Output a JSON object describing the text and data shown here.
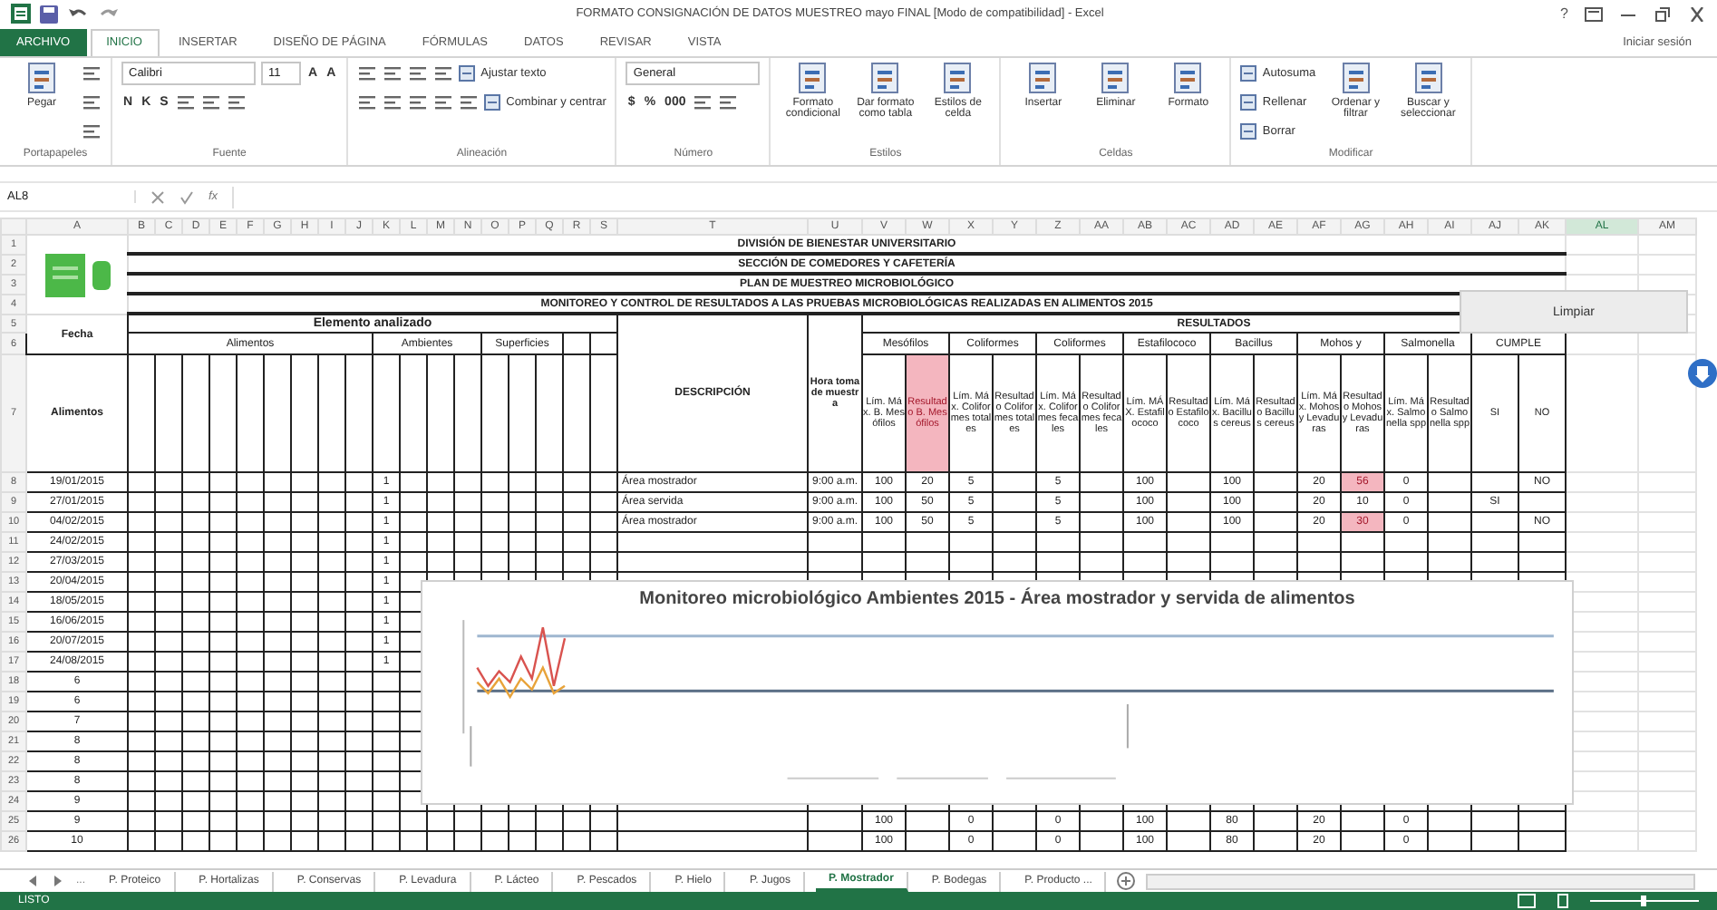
{
  "window": {
    "title": "FORMATO CONSIGNACIÓN DE DATOS MUESTREO mayo FINAL [Modo de compatibilidad] - Excel",
    "help": "?"
  },
  "ribbon_tabs": [
    {
      "label": "ARCHIVO",
      "kind": "file"
    },
    {
      "label": "INICIO",
      "kind": "tab",
      "selected": true
    },
    {
      "label": "INSERTAR",
      "kind": "tab",
      "selected": false
    },
    {
      "label": "DISEÑO DE PÁGINA",
      "kind": "tab",
      "selected": false
    },
    {
      "label": "FÓRMULAS",
      "kind": "tab",
      "selected": false
    },
    {
      "label": "DATOS",
      "kind": "tab",
      "selected": false
    },
    {
      "label": "REVISAR",
      "kind": "tab",
      "selected": false
    },
    {
      "label": "VISTA",
      "kind": "tab",
      "selected": false
    }
  ],
  "sign_in": "Iniciar sesión",
  "ribbon_groups": [
    {
      "label": "Portapapeles",
      "items": [
        {
          "kind": "large",
          "label": "Pegar"
        },
        {
          "kind": "stack",
          "lines": [
            {
              "items": [
                {
                  "kind": "icon"
                }
              ]
            },
            {
              "items": [
                {
                  "kind": "icon"
                }
              ]
            },
            {
              "items": [
                {
                  "kind": "icon"
                }
              ]
            }
          ]
        }
      ]
    },
    {
      "label": "Fuente",
      "items": [
        {
          "kind": "stack",
          "lines": [
            {
              "items": [
                {
                  "kind": "field",
                  "label": "Calibri"
                },
                {
                  "kind": "smallfield",
                  "label": "11"
                },
                {
                  "kind": "glyph",
                  "label": "A"
                },
                {
                  "kind": "glyph",
                  "label": "A"
                }
              ]
            },
            {
              "items": [
                {
                  "kind": "glyph",
                  "label": "N"
                },
                {
                  "kind": "glyph",
                  "label": "K"
                },
                {
                  "kind": "glyph",
                  "label": "S"
                },
                {
                  "kind": "icon"
                },
                {
                  "kind": "icon"
                },
                {
                  "kind": "icon"
                }
              ]
            }
          ]
        }
      ]
    },
    {
      "label": "Alineación",
      "items": [
        {
          "kind": "stack",
          "lines": [
            {
              "items": [
                {
                  "kind": "icon"
                },
                {
                  "kind": "icon"
                },
                {
                  "kind": "icon"
                },
                {
                  "kind": "icon"
                },
                {
                  "kind": "labeled",
                  "label": "Ajustar texto"
                }
              ]
            },
            {
              "items": [
                {
                  "kind": "icon"
                },
                {
                  "kind": "icon"
                },
                {
                  "kind": "icon"
                },
                {
                  "kind": "icon"
                },
                {
                  "kind": "icon"
                },
                {
                  "kind": "labeled",
                  "label": "Combinar y centrar"
                }
              ]
            }
          ]
        }
      ]
    },
    {
      "label": "Número",
      "items": [
        {
          "kind": "stack",
          "lines": [
            {
              "items": [
                {
                  "kind": "field",
                  "label": "General"
                }
              ]
            },
            {
              "items": [
                {
                  "kind": "glyph",
                  "label": "$"
                },
                {
                  "kind": "glyph",
                  "label": "%"
                },
                {
                  "kind": "glyph",
                  "label": "000"
                },
                {
                  "kind": "icon"
                },
                {
                  "kind": "icon"
                }
              ]
            }
          ]
        }
      ]
    },
    {
      "label": "Estilos",
      "items": [
        {
          "kind": "large",
          "label": "Formato condicional"
        },
        {
          "kind": "large",
          "label": "Dar formato como tabla"
        },
        {
          "kind": "large",
          "label": "Estilos de celda"
        }
      ]
    },
    {
      "label": "Celdas",
      "items": [
        {
          "kind": "large",
          "label": "Insertar"
        },
        {
          "kind": "large",
          "label": "Eliminar"
        },
        {
          "kind": "large",
          "label": "Formato"
        }
      ]
    },
    {
      "label": "Modificar",
      "items": [
        {
          "kind": "stack",
          "lines": [
            {
              "items": [
                {
                  "kind": "labeled",
                  "label": "Autosuma"
                }
              ]
            },
            {
              "items": [
                {
                  "kind": "labeled",
                  "label": "Rellenar"
                }
              ]
            },
            {
              "items": [
                {
                  "kind": "labeled",
                  "label": "Borrar"
                }
              ]
            }
          ]
        },
        {
          "kind": "large",
          "label": "Ordenar y filtrar"
        },
        {
          "kind": "large",
          "label": "Buscar y seleccionar"
        }
      ]
    }
  ],
  "formula_bar": {
    "name_box": "AL8",
    "function_label": "fx"
  },
  "columns": [
    {
      "label": "A",
      "selected": false
    },
    {
      "label": "B",
      "selected": false
    },
    {
      "label": "C",
      "selected": false
    },
    {
      "label": "D",
      "selected": false
    },
    {
      "label": "E",
      "selected": false
    },
    {
      "label": "F",
      "selected": false
    },
    {
      "label": "G",
      "selected": false
    },
    {
      "label": "H",
      "selected": false
    },
    {
      "label": "I",
      "selected": false
    },
    {
      "label": "J",
      "selected": false
    },
    {
      "label": "K",
      "selected": false
    },
    {
      "label": "L",
      "selected": false
    },
    {
      "label": "M",
      "selected": false
    },
    {
      "label": "N",
      "selected": false
    },
    {
      "label": "O",
      "selected": false
    },
    {
      "label": "P",
      "selected": false
    },
    {
      "label": "Q",
      "selected": false
    },
    {
      "label": "R",
      "selected": false
    },
    {
      "label": "S",
      "selected": false
    },
    {
      "label": "T",
      "selected": false
    },
    {
      "label": "U",
      "selected": false
    },
    {
      "label": "V",
      "selected": false
    },
    {
      "label": "W",
      "selected": false
    },
    {
      "label": "X",
      "selected": false
    },
    {
      "label": "Y",
      "selected": false
    },
    {
      "label": "Z",
      "selected": false
    },
    {
      "label": "AA",
      "selected": false
    },
    {
      "label": "AB",
      "selected": false
    },
    {
      "label": "AC",
      "selected": false
    },
    {
      "label": "AD",
      "selected": false
    },
    {
      "label": "AE",
      "selected": false
    },
    {
      "label": "AF",
      "selected": false
    },
    {
      "label": "AG",
      "selected": false
    },
    {
      "label": "AH",
      "selected": false
    },
    {
      "label": "AI",
      "selected": false
    },
    {
      "label": "AJ",
      "selected": false
    },
    {
      "label": "AK",
      "selected": false
    },
    {
      "label": "AL",
      "selected": true
    },
    {
      "label": "AM",
      "selected": false
    }
  ],
  "sheet": {
    "header_row_numbers": [
      "1",
      "2",
      "3",
      "4",
      "5",
      "6",
      "7"
    ],
    "titles": [
      "DIVISIÓN DE BIENESTAR UNIVERSITARIO",
      "SECCIÓN DE COMEDORES Y CAFETERÍA",
      "PLAN DE MUESTREO MICROBIOLÓGICO",
      "MONITOREO Y CONTROL DE RESULTADOS A LAS PRUEBAS MICROBIOLÓGICAS REALIZADAS EN ALIMENTOS 2015"
    ],
    "clear_button": "Limpiar",
    "header": {
      "date": "Fecha",
      "element": "Elemento analizado",
      "groups": [
        "Alimentos",
        "Ambientes",
        "Superficies"
      ],
      "food": "Alimentos",
      "description": "DESCRIPCIÓN",
      "time": "Hora toma de muestra",
      "results": "RESULTADOS",
      "result_groups": [
        "Mesófilos",
        "Coliformes",
        "Coliformes",
        "Estafilococo",
        "Bacillus",
        "Mohos y",
        "Salmonella",
        "CUMPLE"
      ],
      "result_columns": [
        {
          "label": "Lím. Máx. B. Mesófilos",
          "alert": false
        },
        {
          "label": "Resultado B. Mesófilos",
          "alert": true
        },
        {
          "label": "Lím. Máx. Coliformes totales",
          "alert": false
        },
        {
          "label": "Resultado Coliformes totales",
          "alert": false
        },
        {
          "label": "Lím. Máx. Coliformes fecales",
          "alert": false
        },
        {
          "label": "Resultado Coliformes fecales",
          "alert": false
        },
        {
          "label": "Lím. MÁX. Estafilococo",
          "alert": false
        },
        {
          "label": "Resultado Estafilococo",
          "alert": false
        },
        {
          "label": "Lím. Máx. Bacillus cereus",
          "alert": false
        },
        {
          "label": "Resultado Bacillus cereus",
          "alert": false
        },
        {
          "label": "Lím. Máx. Mohos y Levaduras",
          "alert": false
        },
        {
          "label": "Resultado Mohos y Levaduras",
          "alert": false
        },
        {
          "label": "Lím. Máx. Salmonella spp",
          "alert": false
        },
        {
          "label": "Resultado Salmonella spp",
          "alert": false
        },
        {
          "label": "SI",
          "alert": false
        },
        {
          "label": "NO",
          "alert": false
        }
      ]
    },
    "rows": [
      {
        "n": "8",
        "date": "19/01/2015",
        "mark": "1",
        "description": "Área mostrador",
        "time": "9:00 a.m.",
        "results": [
          {
            "text": "100",
            "alert": false
          },
          {
            "text": "20",
            "alert": false
          },
          {
            "text": "5",
            "alert": false
          },
          {
            "alert": false
          },
          {
            "text": "5",
            "alert": false
          },
          {
            "alert": false
          },
          {
            "text": "100",
            "alert": false
          },
          {
            "alert": false
          },
          {
            "text": "100",
            "alert": false
          },
          {
            "alert": false
          },
          {
            "text": "20",
            "alert": false
          },
          {
            "text": "56",
            "alert": true
          },
          {
            "text": "0",
            "alert": false
          },
          {
            "alert": false
          },
          {
            "alert": false
          },
          {
            "text": "NO",
            "alert": false
          }
        ]
      },
      {
        "n": "9",
        "date": "27/01/2015",
        "mark": "1",
        "description": "Área servida",
        "time": "9:00 a.m.",
        "results": [
          {
            "text": "100",
            "alert": false
          },
          {
            "text": "50",
            "alert": false
          },
          {
            "text": "5",
            "alert": false
          },
          {
            "alert": false
          },
          {
            "text": "5",
            "alert": false
          },
          {
            "alert": false
          },
          {
            "text": "100",
            "alert": false
          },
          {
            "alert": false
          },
          {
            "text": "100",
            "alert": false
          },
          {
            "alert": false
          },
          {
            "text": "20",
            "alert": false
          },
          {
            "text": "10",
            "alert": false
          },
          {
            "text": "0",
            "alert": false
          },
          {
            "alert": false
          },
          {
            "text": "SI",
            "alert": false
          },
          {
            "alert": false
          }
        ]
      },
      {
        "n": "10",
        "date": "04/02/2015",
        "mark": "1",
        "description": "Área mostrador",
        "time": "9:00 a.m.",
        "results": [
          {
            "text": "100",
            "alert": false
          },
          {
            "text": "50",
            "alert": false
          },
          {
            "text": "5",
            "alert": false
          },
          {
            "alert": false
          },
          {
            "text": "5",
            "alert": false
          },
          {
            "alert": false
          },
          {
            "text": "100",
            "alert": false
          },
          {
            "alert": false
          },
          {
            "text": "100",
            "alert": false
          },
          {
            "alert": false
          },
          {
            "text": "20",
            "alert": false
          },
          {
            "text": "30",
            "alert": true
          },
          {
            "text": "0",
            "alert": false
          },
          {
            "alert": false
          },
          {
            "alert": false
          },
          {
            "text": "NO",
            "alert": false
          }
        ]
      },
      {
        "n": "11",
        "date": "24/02/2015",
        "mark": "1"
      },
      {
        "n": "12",
        "date": "27/03/2015",
        "mark": "1"
      },
      {
        "n": "13",
        "date": "20/04/2015",
        "mark": "1"
      },
      {
        "n": "14",
        "date": "18/05/2015",
        "mark": "1"
      },
      {
        "n": "15",
        "date": "16/06/2015",
        "mark": "1"
      },
      {
        "n": "16",
        "date": "20/07/2015",
        "mark": "1"
      },
      {
        "n": "17",
        "date": "24/08/2015",
        "mark": "1"
      },
      {
        "n": "18",
        "date": "6"
      },
      {
        "n": "19",
        "date": "6"
      },
      {
        "n": "20",
        "date": "7"
      },
      {
        "n": "21",
        "date": "8"
      },
      {
        "n": "22",
        "date": "8"
      },
      {
        "n": "23",
        "date": "8"
      },
      {
        "n": "24",
        "date": "9"
      },
      {
        "n": "25",
        "date": "9",
        "results": [
          {
            "text": "100",
            "alert": false
          },
          {
            "alert": false
          },
          {
            "text": "0",
            "alert": false
          },
          {
            "alert": false
          },
          {
            "text": "0",
            "alert": false
          },
          {
            "alert": false
          },
          {
            "text": "100",
            "alert": false
          },
          {
            "alert": false
          },
          {
            "text": "80",
            "alert": false
          },
          {
            "alert": false
          },
          {
            "text": "20",
            "alert": false
          },
          {
            "alert": false
          },
          {
            "text": "0",
            "alert": false
          },
          {
            "alert": false
          },
          {
            "alert": false
          },
          {
            "alert": false
          }
        ]
      },
      {
        "n": "26",
        "date": "10",
        "results": [
          {
            "text": "100",
            "alert": false
          },
          {
            "alert": false
          },
          {
            "text": "0",
            "alert": false
          },
          {
            "alert": false
          },
          {
            "text": "0",
            "alert": false
          },
          {
            "alert": false
          },
          {
            "text": "100",
            "alert": false
          },
          {
            "alert": false
          },
          {
            "text": "80",
            "alert": false
          },
          {
            "alert": false
          },
          {
            "text": "20",
            "alert": false
          },
          {
            "alert": false
          },
          {
            "text": "0",
            "alert": false
          },
          {
            "alert": false
          },
          {
            "alert": false
          },
          {
            "alert": false
          }
        ]
      }
    ]
  },
  "chart": {
    "title": "Monitoreo microbiológico Ambientes 2015 - Área mostrador y servida de alimentos"
  },
  "sheet_tabs": {
    "more": "...",
    "tabs": [
      {
        "label": "P. Proteico",
        "selected": false
      },
      {
        "label": "P. Hortalizas",
        "selected": false
      },
      {
        "label": "P. Conservas",
        "selected": false
      },
      {
        "label": "P. Levadura",
        "selected": false
      },
      {
        "label": "P. Lácteo",
        "selected": false
      },
      {
        "label": "P. Pescados",
        "selected": false
      },
      {
        "label": "P. Hielo",
        "selected": false
      },
      {
        "label": "P. Jugos",
        "selected": false
      },
      {
        "label": "P. Mostrador",
        "selected": true
      },
      {
        "label": "P. Bodegas",
        "selected": false
      },
      {
        "label": "P. Producto ...",
        "selected": false
      }
    ]
  },
  "status_bar": {
    "text": "LISTO"
  }
}
